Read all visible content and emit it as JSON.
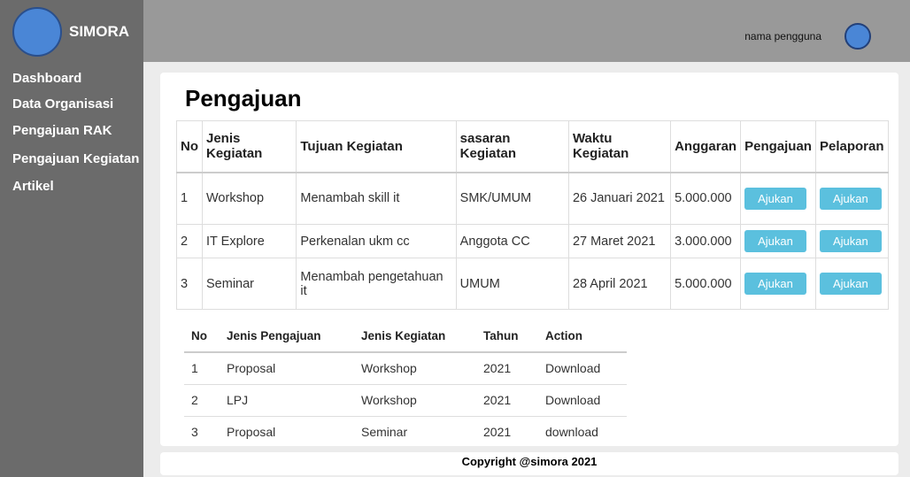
{
  "app": {
    "name": "SIMORA"
  },
  "sidebar": {
    "items": [
      {
        "label": "Dashboard"
      },
      {
        "label": "Data Organisasi"
      },
      {
        "label": "Pengajuan RAK"
      },
      {
        "label": "Pengajuan Kegiatan"
      },
      {
        "label": "Artikel"
      }
    ]
  },
  "header": {
    "username": "nama pengguna"
  },
  "main": {
    "title": "Pengajuan",
    "activities": {
      "headers": [
        "No",
        "Jenis Kegiatan",
        "Tujuan Kegiatan",
        "sasaran Kegiatan",
        "Waktu Kegiatan",
        "Anggaran",
        "Pengajuan",
        "Pelaporan"
      ],
      "rows": [
        {
          "no": "1",
          "jenis": "Workshop",
          "tujuan": "Menambah skill it",
          "sasaran": "SMK/UMUM",
          "waktu": "26 Januari 2021",
          "anggaran": "5.000.000",
          "pengajuan": "Ajukan",
          "pelaporan": "Ajukan"
        },
        {
          "no": "2",
          "jenis": "IT Explore",
          "tujuan": "Perkenalan ukm cc",
          "sasaran": "Anggota CC",
          "waktu": "27 Maret 2021",
          "anggaran": "3.000.000",
          "pengajuan": "Ajukan",
          "pelaporan": "Ajukan"
        },
        {
          "no": "3",
          "jenis": "Seminar",
          "tujuan": "Menambah pengetahuan it",
          "sasaran": "UMUM",
          "waktu": "28 April 2021",
          "anggaran": "5.000.000",
          "pengajuan": "Ajukan",
          "pelaporan": "Ajukan"
        }
      ]
    },
    "documents": {
      "headers": [
        "No",
        "Jenis Pengajuan",
        "Jenis Kegiatan",
        "Tahun",
        "Action"
      ],
      "rows": [
        {
          "no": "1",
          "jenis_pengajuan": "Proposal",
          "jenis_kegiatan": "Workshop",
          "tahun": "2021",
          "action": "Download"
        },
        {
          "no": "2",
          "jenis_pengajuan": "LPJ",
          "jenis_kegiatan": "Workshop",
          "tahun": "2021",
          "action": "Download"
        },
        {
          "no": "3",
          "jenis_pengajuan": "Proposal",
          "jenis_kegiatan": "Seminar",
          "tahun": "2021",
          "action": "download"
        }
      ]
    }
  },
  "footer": {
    "text": "Copyright @simora 2021"
  },
  "colors": {
    "sidebar": "#6b6b6b",
    "header": "#999999",
    "accent": "#4a86d6",
    "button": "#5bc0de"
  }
}
